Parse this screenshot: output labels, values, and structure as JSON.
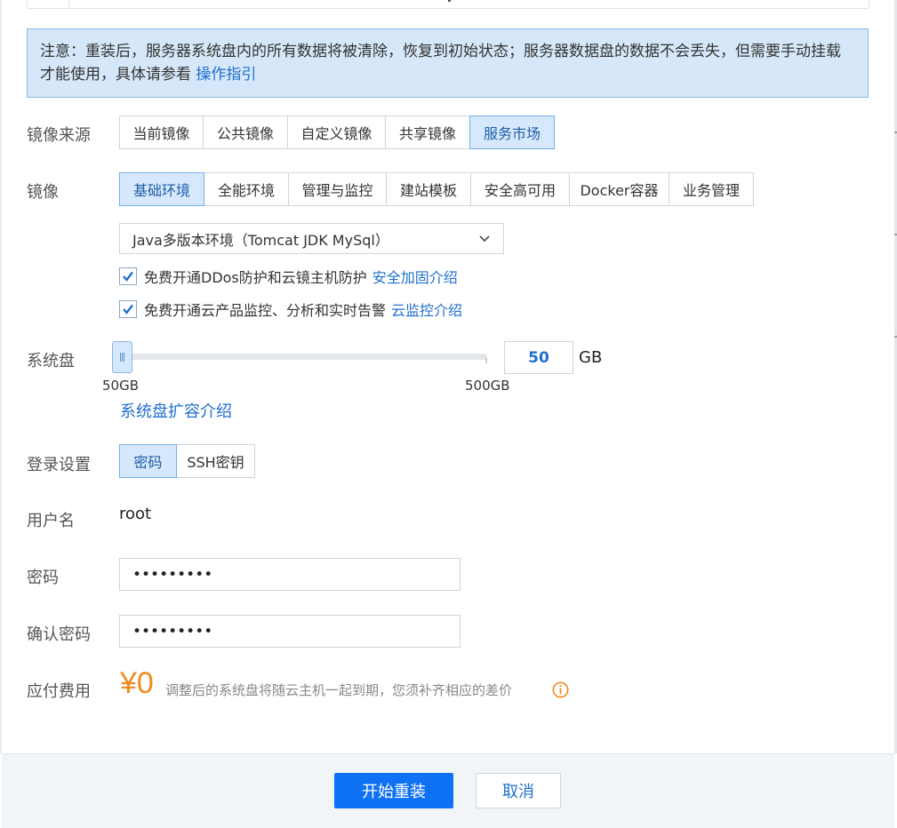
{
  "notice": {
    "text": "注意：重装后，服务器系统盘内的所有数据将被清除，恢复到初始状态；服务器数据盘的数据不会丢失，但需要手动挂载才能使用，具体请参看 ",
    "link": "操作指引"
  },
  "image_source": {
    "label": "镜像来源",
    "options": [
      "当前镜像",
      "公共镜像",
      "自定义镜像",
      "共享镜像",
      "服务市场"
    ],
    "selected": "服务市场"
  },
  "image": {
    "label": "镜像",
    "categories": [
      "基础环境",
      "全能环境",
      "管理与监控",
      "建站模板",
      "安全高可用",
      "Docker容器",
      "业务管理"
    ],
    "selected_category": "基础环境",
    "selected_image": "Java多版本环境（Tomcat JDK MySql）"
  },
  "options": {
    "ddos": {
      "text": "免费开通DDos防护和云镜主机防护",
      "link": "安全加固介绍",
      "checked": true
    },
    "monitor": {
      "text": "免费开通云产品监控、分析和实时告警",
      "link": "云监控介绍",
      "checked": true
    }
  },
  "system_disk": {
    "label": "系统盘",
    "min_label": "50GB",
    "max_label": "500GB",
    "value": "50",
    "min": 50,
    "max": 500,
    "unit": "GB",
    "expand_link": "系统盘扩容介绍"
  },
  "login": {
    "label": "登录设置",
    "options": [
      "密码",
      "SSH密钥"
    ],
    "selected": "密码"
  },
  "username": {
    "label": "用户名",
    "value": "root"
  },
  "password": {
    "label": "密码",
    "value": "•••••••••"
  },
  "confirm_password": {
    "label": "确认密码",
    "value": "•••••••••"
  },
  "fee": {
    "label": "应付费用",
    "amount": "¥0",
    "note": "调整后的系统盘将随云主机一起到期，您须补齐相应的差价"
  },
  "actions": {
    "start": "开始重装",
    "cancel": "取消"
  },
  "colors": {
    "accent": "#0f72f5",
    "link": "#1f6fcf",
    "price": "#f08a1c",
    "notice_bg": "#d5e7f8"
  }
}
